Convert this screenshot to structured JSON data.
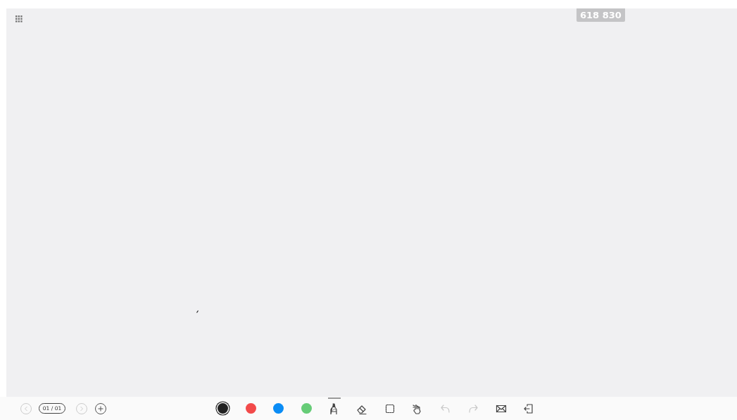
{
  "room_code": "618 830",
  "pager": {
    "page": "01 / 01",
    "prev_disabled": true,
    "next_disabled": true
  },
  "colors": [
    {
      "color": "#222222",
      "selected": true
    },
    {
      "color": "#f24a4a",
      "selected": false
    },
    {
      "color": "#0a8cf5",
      "selected": false
    },
    {
      "color": "#66cc77",
      "selected": false
    }
  ],
  "tools": [
    {
      "kind": "pen",
      "selected": true,
      "disabled": false
    },
    {
      "kind": "eraser",
      "selected": false,
      "disabled": false
    },
    {
      "kind": "select",
      "selected": false,
      "disabled": false
    },
    {
      "kind": "lasso",
      "selected": false,
      "disabled": false
    },
    {
      "kind": "undo",
      "selected": false,
      "disabled": true
    },
    {
      "kind": "redo",
      "selected": false,
      "disabled": true
    },
    {
      "kind": "mail",
      "selected": false,
      "disabled": false
    },
    {
      "kind": "exit",
      "selected": false,
      "disabled": false
    }
  ]
}
